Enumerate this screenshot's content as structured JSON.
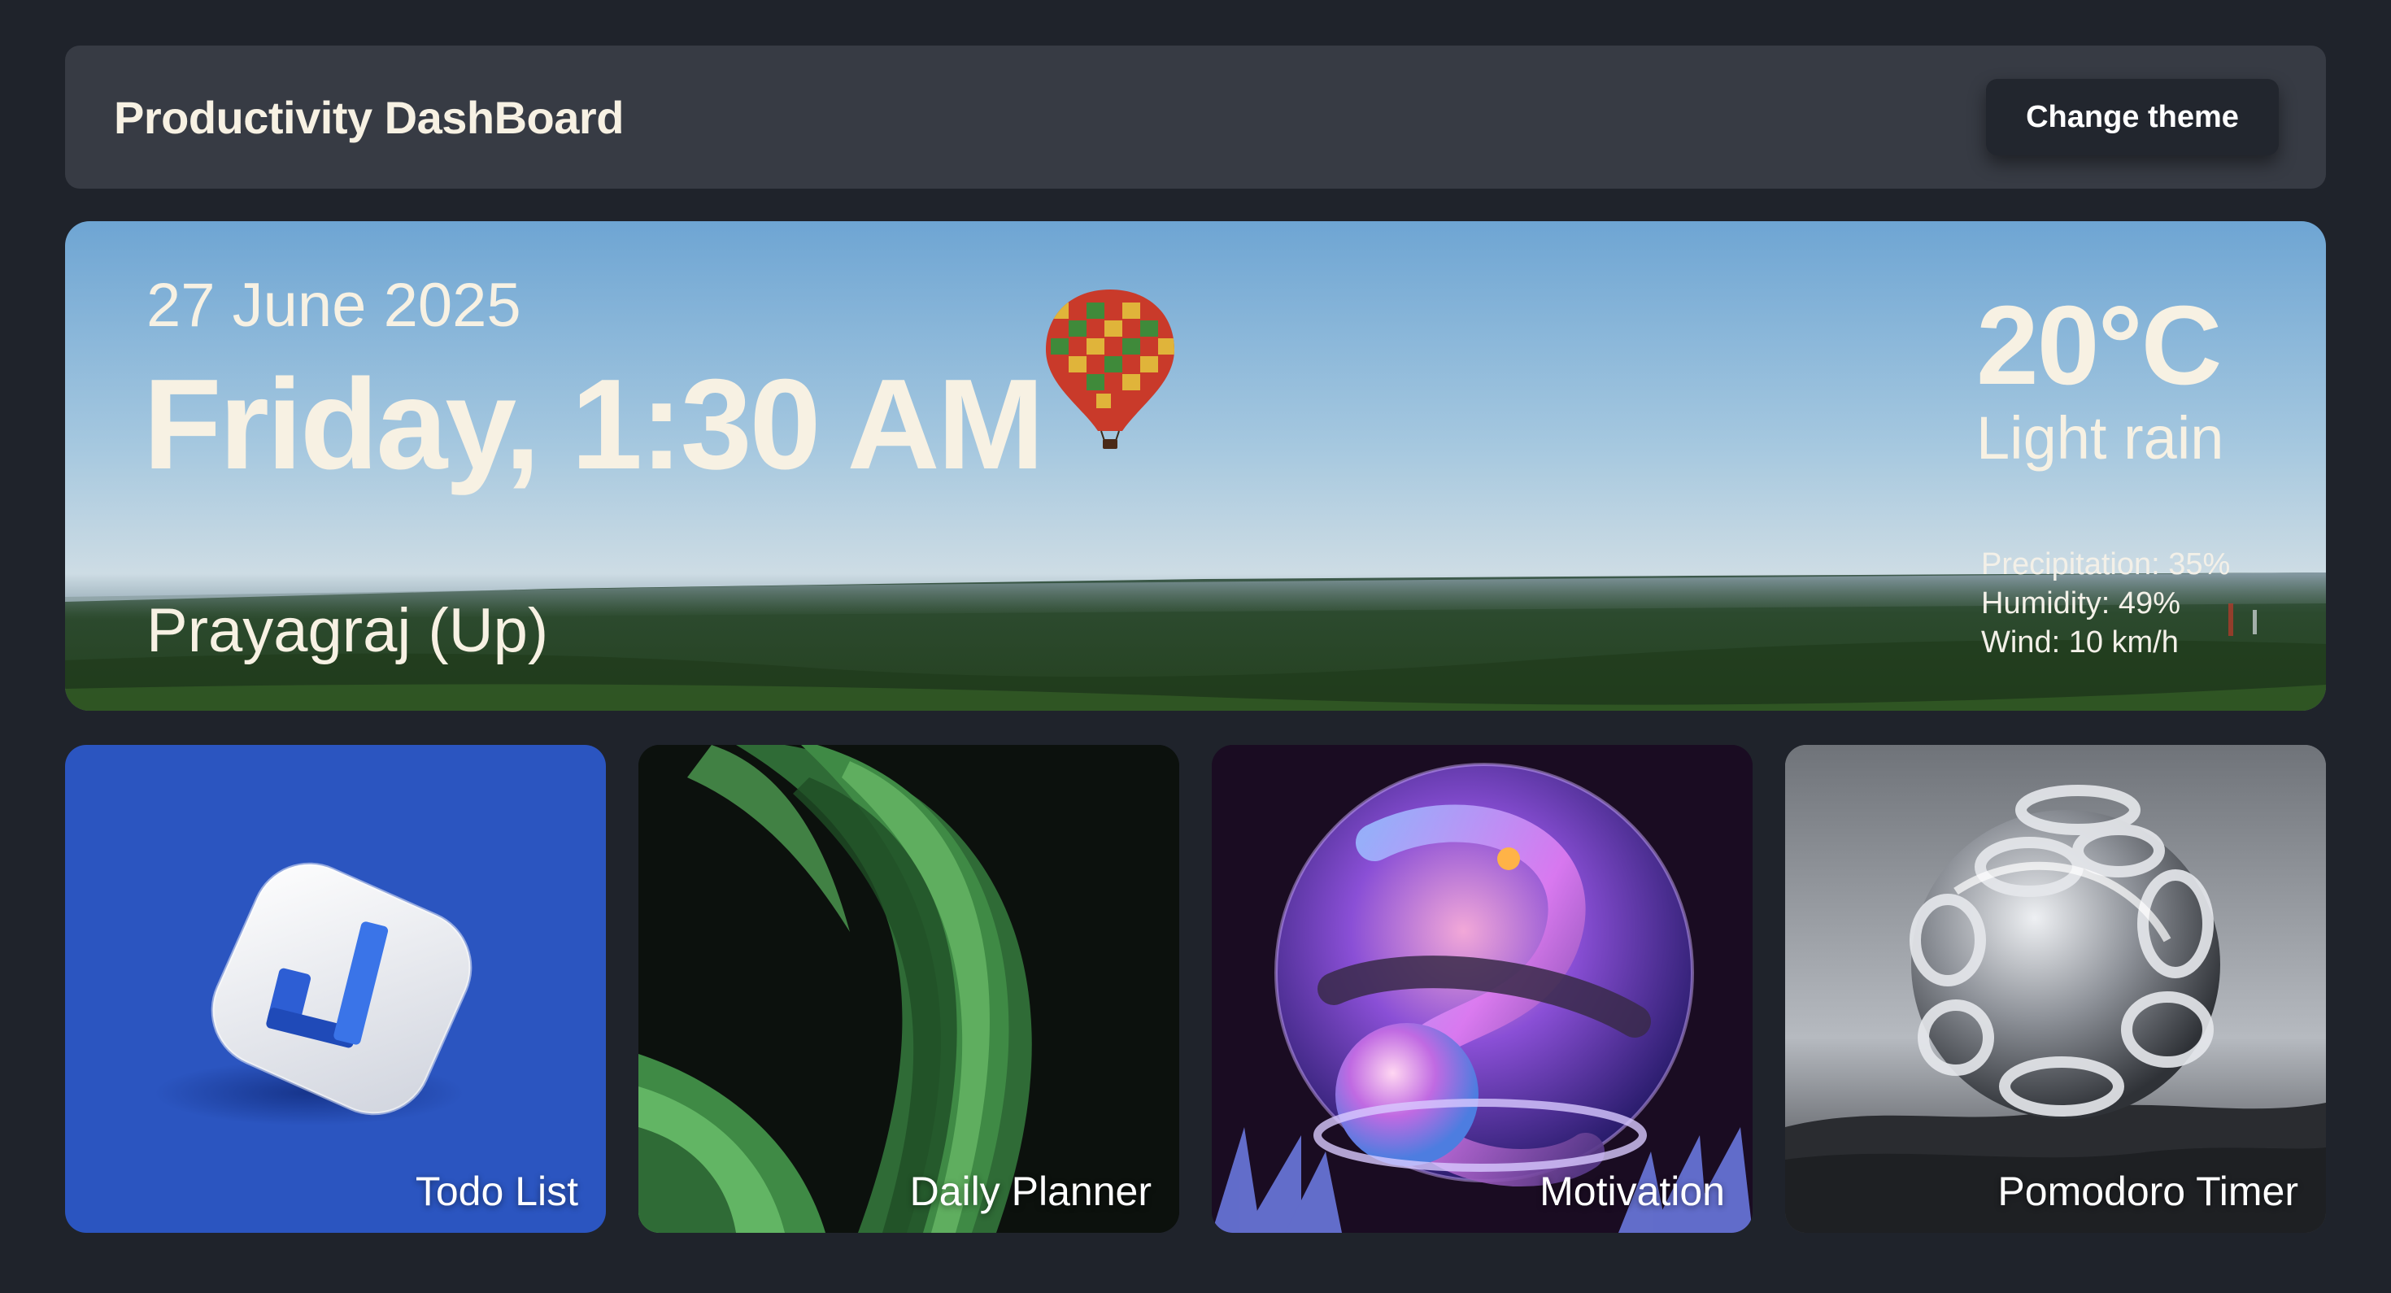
{
  "header": {
    "title": "Productivity DashBoard",
    "theme_button": "Change theme"
  },
  "hero": {
    "date": "27 June 2025",
    "day_time": "Friday, 1:30 AM",
    "location": "Prayagraj (Up)",
    "weather": {
      "temperature": "20°C",
      "condition": "Light rain",
      "precipitation": "Precipitation: 35%",
      "humidity": "Humidity: 49%",
      "wind": "Wind: 10 km/h"
    }
  },
  "cards": [
    {
      "label": "Todo List"
    },
    {
      "label": "Daily Planner"
    },
    {
      "label": "Motivation"
    },
    {
      "label": "Pomodoro Timer"
    }
  ],
  "colors": {
    "background": "#1f232b",
    "header_bg": "#373b44",
    "button_bg": "#22262e",
    "text_cream": "#f7f1e3",
    "todo_blue": "#2b55c0"
  },
  "icons": {
    "todo": "checkmark-tile-icon",
    "planner": "green-ribbon-art",
    "motivation": "iridescent-sphere-art",
    "pomodoro": "silver-sphere-art",
    "hero": "hot-air-balloon"
  }
}
